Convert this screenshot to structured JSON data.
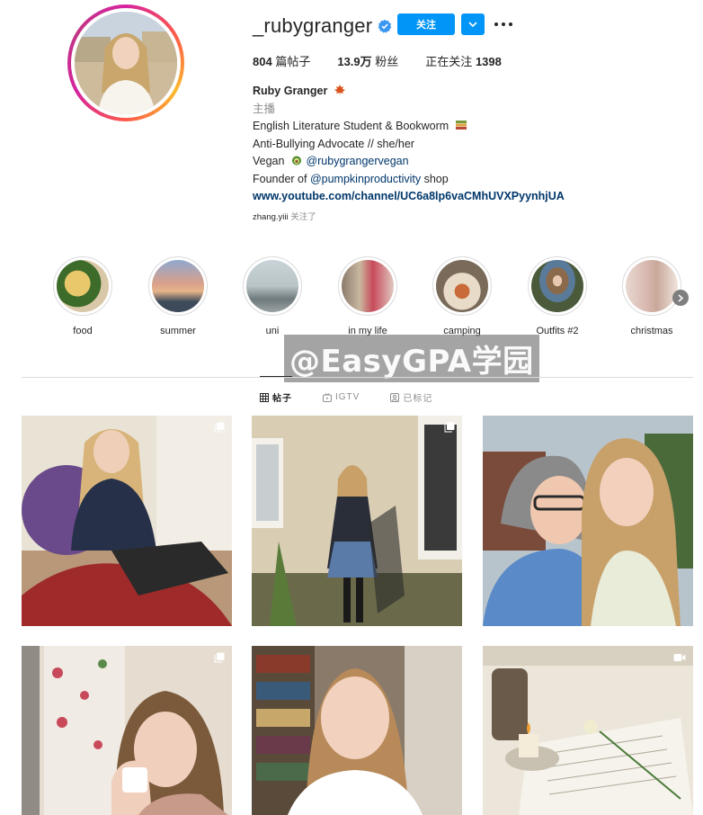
{
  "profile": {
    "username": "_rubygranger",
    "follow_label": "关注",
    "stats": {
      "posts": "804",
      "posts_label": "篇帖子",
      "followers": "13.9万",
      "followers_label": "粉丝",
      "following_label": "正在关注",
      "following": "1398"
    },
    "bio": {
      "name": "Ruby Granger",
      "category": "主播",
      "line1": "English Literature Student & Bookworm",
      "line2": "Anti-Bullying Advocate // she/her",
      "line3_prefix": "Vegan",
      "line3_mention": "@rubygrangervegan",
      "line4_prefix": "Founder of",
      "line4_mention": "@pumpkinproductivity",
      "line4_suffix": "shop",
      "link": "www.youtube.com/channel/UC6a8lp6vaCMhUVXPyynhjUA"
    },
    "followed_by_user": "zhang.yiii",
    "followed_by_suffix": "关注了"
  },
  "highlights": [
    {
      "label": "food"
    },
    {
      "label": "summer"
    },
    {
      "label": "uni"
    },
    {
      "label": "in my life"
    },
    {
      "label": "camping"
    },
    {
      "label": "Outfits #2"
    },
    {
      "label": "christmas"
    }
  ],
  "watermark": "@EasyGPA学园",
  "tabs": [
    {
      "label": "帖子",
      "icon": "grid-icon",
      "active": true
    },
    {
      "label": "IGTV",
      "icon": "igtv-icon",
      "active": false
    },
    {
      "label": "已标记",
      "icon": "tagged-icon",
      "active": false
    }
  ],
  "posts": [
    {
      "type": "carousel"
    },
    {
      "type": "carousel"
    },
    {
      "type": "photo"
    },
    {
      "type": "carousel"
    },
    {
      "type": "photo"
    },
    {
      "type": "video"
    }
  ],
  "colors": {
    "accent": "#0095f6",
    "text": "#262626",
    "muted": "#8e8e8e",
    "link": "#00376b",
    "border": "#dbdbdb"
  }
}
